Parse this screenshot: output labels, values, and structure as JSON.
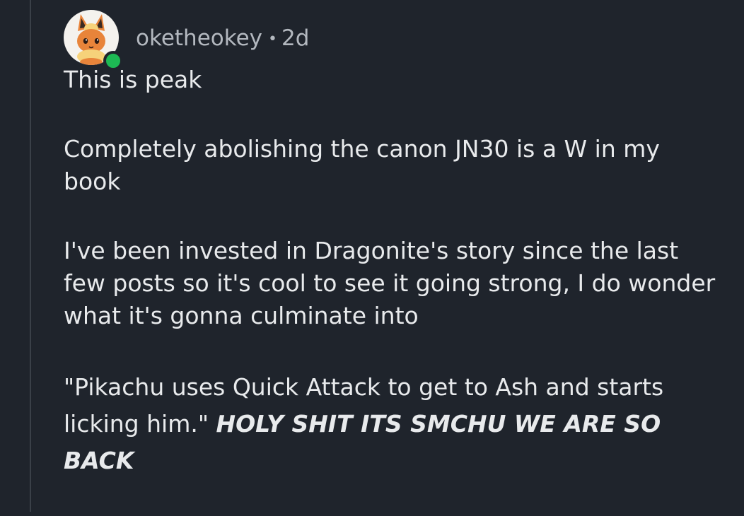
{
  "comment": {
    "username": "oketheokey",
    "separator": "•",
    "age": "2d",
    "online": true,
    "paragraphs": [
      "This is peak",
      "Completely abolishing the canon JN30 is a W in my book",
      "I've been invested in Dragonite's story since the last few posts so it's cool to see it going strong, I do wonder what it's gonna culminate into"
    ],
    "last_paragraph": {
      "quote": "\"Pikachu uses Quick Attack to get to Ash and starts licking him.\"",
      "emphasis": "HOLY SHIT ITS SMCHU WE ARE SO BACK"
    }
  },
  "colors": {
    "background": "#1f242c",
    "text": "#e8eaec",
    "meta_text": "#b3b8bf",
    "online_indicator": "#1db954",
    "thread_line": "#3a4048"
  }
}
